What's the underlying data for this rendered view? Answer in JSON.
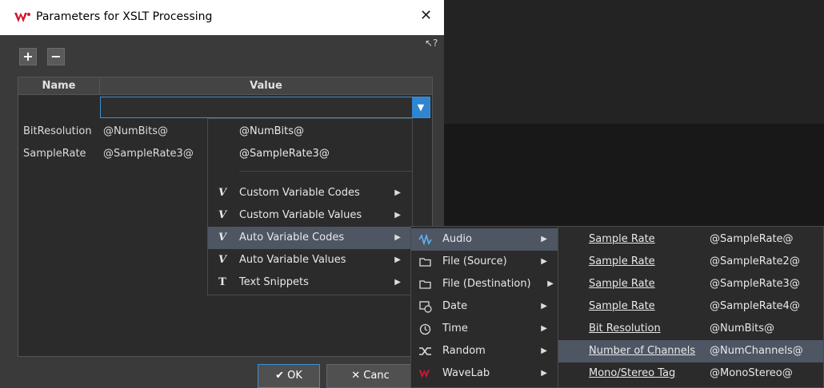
{
  "dialog": {
    "title": "Parameters for XSLT Processing",
    "close_label": "✕",
    "help_label": "↖?",
    "toolbar": {
      "add_label": "+",
      "remove_label": "−"
    },
    "table": {
      "headers": [
        "Name",
        "Value"
      ],
      "rows": [
        {
          "name": "BitResolution",
          "value": "@NumBits@"
        },
        {
          "name": "SampleRate",
          "value": "@SampleRate3@"
        }
      ],
      "edit_value": ""
    },
    "buttons": {
      "ok": "OK",
      "cancel": "Canc"
    }
  },
  "menu1": {
    "recent": [
      "@NumBits@",
      "@SampleRate3@"
    ],
    "items": [
      {
        "icon": "V",
        "label": "Custom Variable Codes"
      },
      {
        "icon": "V",
        "label": "Custom Variable Values"
      },
      {
        "icon": "V",
        "label": "Auto Variable Codes"
      },
      {
        "icon": "V",
        "label": "Auto Variable Values"
      },
      {
        "icon": "T",
        "label": "Text Snippets"
      }
    ]
  },
  "menu2": {
    "items": [
      {
        "icon": "waveform-icon",
        "label": "Audio"
      },
      {
        "icon": "folder-icon",
        "label": "File (Source)"
      },
      {
        "icon": "folder-icon",
        "label": "File (Destination)"
      },
      {
        "icon": "calendar-icon",
        "label": "Date"
      },
      {
        "icon": "clock-icon",
        "label": "Time"
      },
      {
        "icon": "shuffle-icon",
        "label": "Random"
      },
      {
        "icon": "wavelab-icon",
        "label": "WaveLab"
      }
    ]
  },
  "menu3": {
    "items": [
      {
        "name": "Sample Rate",
        "code": "@SampleRate@"
      },
      {
        "name": "Sample Rate",
        "code": "@SampleRate2@"
      },
      {
        "name": "Sample Rate",
        "code": "@SampleRate3@"
      },
      {
        "name": "Sample Rate",
        "code": "@SampleRate4@"
      },
      {
        "name": "Bit Resolution",
        "code": "@NumBits@"
      },
      {
        "name": "Number of Channels",
        "code": "@NumChannels@"
      },
      {
        "name": "Mono/Stereo Tag",
        "code": "@MonoStereo@"
      }
    ]
  },
  "colors": {
    "accent": "#3b8fd6",
    "highlight": "#4e5563",
    "brand": "#d0182f"
  }
}
